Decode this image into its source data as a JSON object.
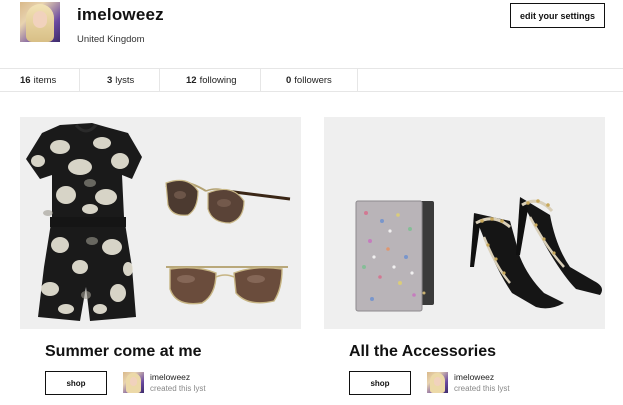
{
  "profile": {
    "username": "imeloweez",
    "location": "United Kingdom",
    "settings_label": "edit your settings"
  },
  "stats": [
    {
      "count": "16",
      "label": "items"
    },
    {
      "count": "3",
      "label": "lysts"
    },
    {
      "count": "12",
      "label": "following"
    },
    {
      "count": "0",
      "label": "followers"
    }
  ],
  "lysts": [
    {
      "title": "Summer come at me",
      "shop_label": "shop",
      "creator": "imeloweez",
      "creator_note": "created this lyst",
      "products": [
        "floral-playsuit",
        "aviator-sunglasses-brown",
        "aviator-sunglasses-gold"
      ]
    },
    {
      "title": "All the Accessories",
      "shop_label": "shop",
      "creator": "imeloweez",
      "creator_note": "created this lyst",
      "products": [
        "glitter-passport-cover",
        "studded-slingback-pumps"
      ]
    }
  ],
  "colors": {
    "text": "#111111",
    "card_bg": "#efefef",
    "divider": "#e6e6e6"
  }
}
